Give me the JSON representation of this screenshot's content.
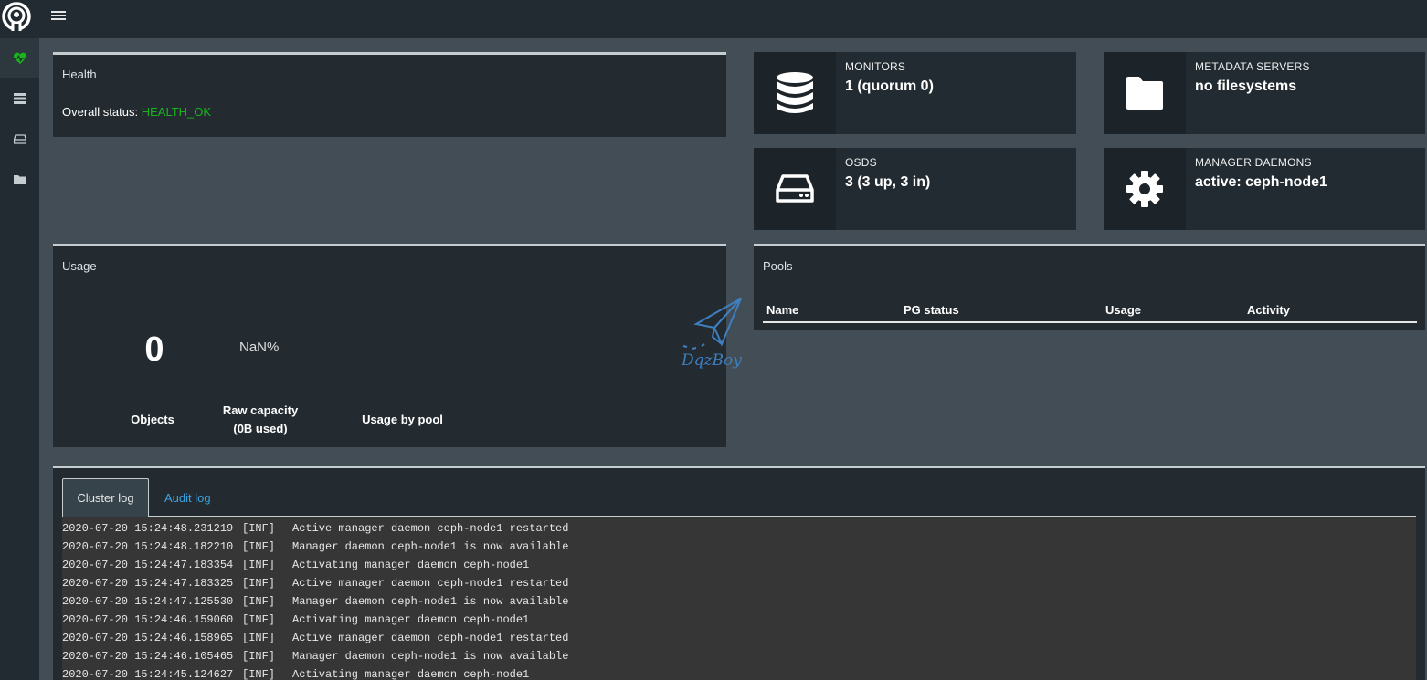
{
  "sidebar": {
    "items": [
      {
        "icon": "heartbeat-icon",
        "active": true
      },
      {
        "icon": "server-icon",
        "active": false
      },
      {
        "icon": "hdd-icon",
        "active": false
      },
      {
        "icon": "folder-icon",
        "active": false
      }
    ]
  },
  "health": {
    "title": "Health",
    "status_label": "Overall status:",
    "status_value": "HEALTH_OK"
  },
  "cards": {
    "monitors": {
      "label": "MONITORS",
      "value": "1 (quorum 0)",
      "icon": "database-icon"
    },
    "mds": {
      "label": "METADATA SERVERS",
      "value": "no filesystems",
      "icon": "folder-icon"
    },
    "osds": {
      "label": "OSDS",
      "value": "3 (3 up, 3 in)",
      "icon": "hdd-icon"
    },
    "mgr": {
      "label": "MANAGER DAEMONS",
      "value": "active: ceph-node1",
      "icon": "gear-icon"
    }
  },
  "usage": {
    "title": "Usage",
    "objects_value": "0",
    "objects_label": "Objects",
    "raw_pct": "NaN%",
    "raw_label": "Raw capacity",
    "raw_used": "(0B used)",
    "by_pool_label": "Usage by pool"
  },
  "pools": {
    "title": "Pools",
    "columns": [
      "Name",
      "PG status",
      "Usage",
      "Activity"
    ]
  },
  "logs": {
    "tabs": [
      "Cluster log",
      "Audit log"
    ],
    "lines": [
      {
        "ts": "2020-07-20 15:24:48.231219",
        "level": "[INF]",
        "msg": "Active manager daemon ceph-node1 restarted"
      },
      {
        "ts": "2020-07-20 15:24:48.182210",
        "level": "[INF]",
        "msg": "Manager daemon ceph-node1 is now available"
      },
      {
        "ts": "2020-07-20 15:24:47.183354",
        "level": "[INF]",
        "msg": "Activating manager daemon ceph-node1"
      },
      {
        "ts": "2020-07-20 15:24:47.183325",
        "level": "[INF]",
        "msg": "Active manager daemon ceph-node1 restarted"
      },
      {
        "ts": "2020-07-20 15:24:47.125530",
        "level": "[INF]",
        "msg": "Manager daemon ceph-node1 is now available"
      },
      {
        "ts": "2020-07-20 15:24:46.159060",
        "level": "[INF]",
        "msg": "Activating manager daemon ceph-node1"
      },
      {
        "ts": "2020-07-20 15:24:46.158965",
        "level": "[INF]",
        "msg": "Active manager daemon ceph-node1 restarted"
      },
      {
        "ts": "2020-07-20 15:24:46.105465",
        "level": "[INF]",
        "msg": "Manager daemon ceph-node1 is now available"
      },
      {
        "ts": "2020-07-20 15:24:45.124627",
        "level": "[INF]",
        "msg": "Activating manager daemon ceph-node1"
      }
    ]
  },
  "watermark": {
    "text": "DqzBoy"
  },
  "colors": {
    "ok": "#19b41c",
    "link": "#3aa4e1",
    "sidebar_active_icon": "#19b41c"
  }
}
